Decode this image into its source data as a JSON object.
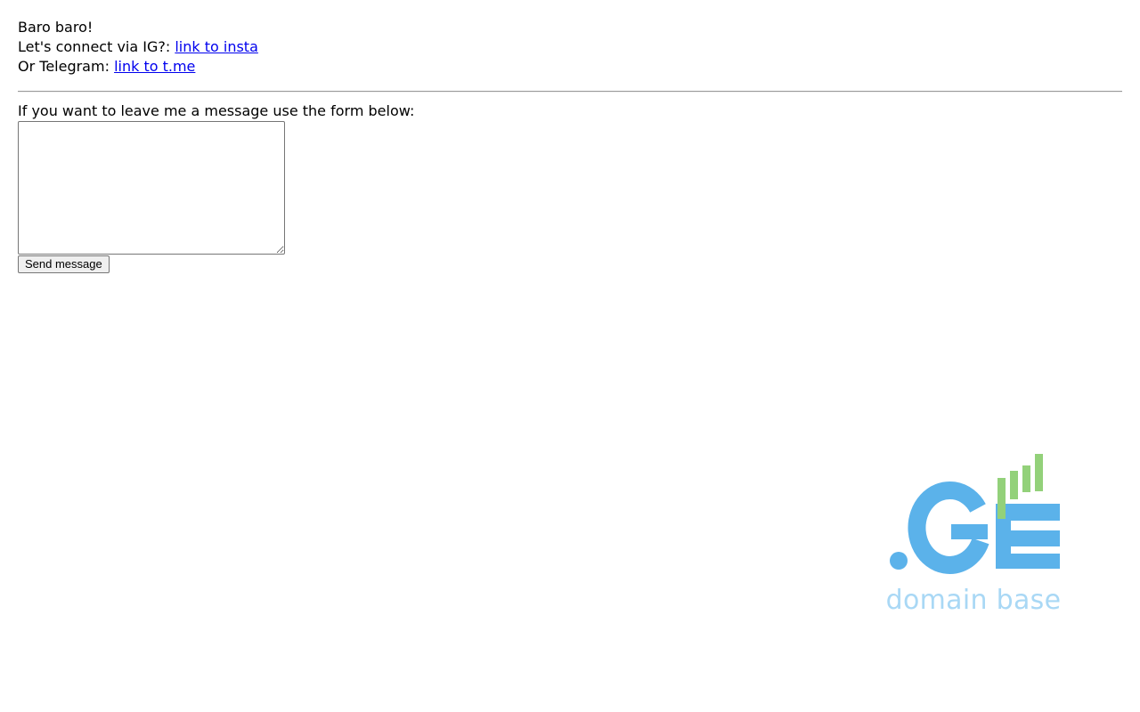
{
  "greeting": "Baro baro!",
  "ig": {
    "prefix": "Let's connect via IG?:",
    "link_text": "link to insta"
  },
  "telegram": {
    "prefix": "Or Telegram:",
    "link_text": "link to t.me"
  },
  "form": {
    "prompt": "If you want to leave me a message use the form below:",
    "message_value": "",
    "submit_label": "Send message"
  },
  "logo": {
    "mark_text": ".GE",
    "tagline": "domain base",
    "colors": {
      "blue": "#5bb2ea",
      "green": "#93d17a",
      "tagline": "#a9d8f5"
    }
  }
}
